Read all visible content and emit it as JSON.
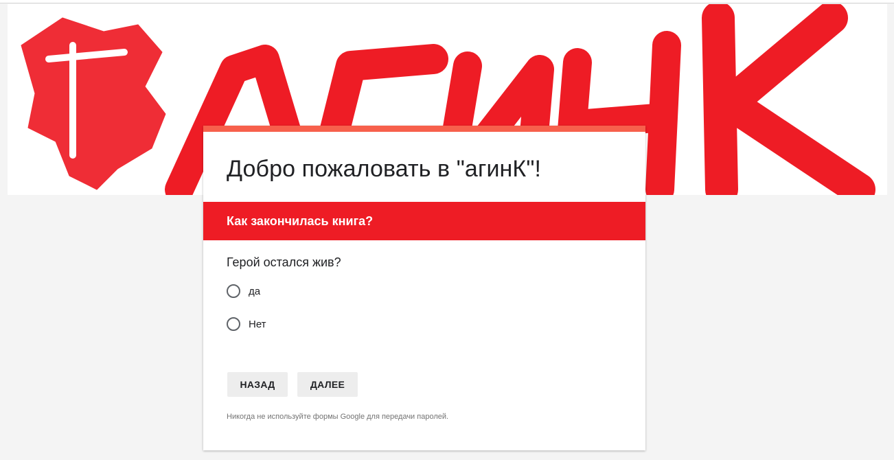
{
  "banner": {
    "image_text": "агинК",
    "stamp_color": "#ee1c25"
  },
  "form": {
    "title": "Добро пожаловать в \"агинК\"!",
    "accent_color": "#f7604c"
  },
  "section": {
    "title": "Как закончилась книга?",
    "color": "#ee1c25"
  },
  "question": {
    "title": "Герой остался жив?",
    "options": [
      {
        "label": "да",
        "selected": false
      },
      {
        "label": "Нет",
        "selected": false
      }
    ]
  },
  "buttons": {
    "back_label": "НАЗАД",
    "next_label": "ДАЛЕЕ"
  },
  "footer": {
    "note": "Никогда не используйте формы Google для передачи паролей."
  }
}
